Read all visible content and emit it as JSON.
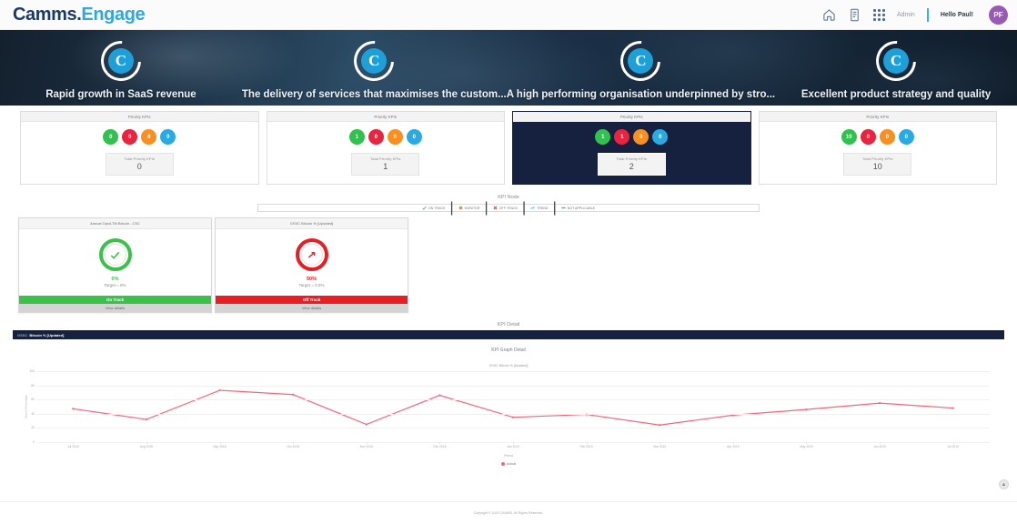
{
  "header": {
    "logo_primary": "Camms.",
    "logo_secondary": "Engage",
    "admin_label": "Admin",
    "greeting": "Hello Paul!",
    "avatar_initials": "PF",
    "icons": {
      "home": "home-icon",
      "reports": "report-icon",
      "apps": "apps-grid-icon"
    }
  },
  "banner": {
    "items": [
      {
        "logo_letter": "C",
        "text": "Rapid growth in SaaS revenue"
      },
      {
        "logo_letter": "C",
        "text": "The delivery of services that maximises the custom..."
      },
      {
        "logo_letter": "C",
        "text": "A high performing organisation underpinned by stro..."
      },
      {
        "logo_letter": "C",
        "text": "Excellent product strategy and quality"
      }
    ]
  },
  "priority_cards": {
    "head_label": "Priority KPIs",
    "total_label": "Total Priority KPIs",
    "cards": [
      {
        "selected": false,
        "badges": [
          {
            "color": "#31c14f",
            "value": "0",
            "icon": "check-icon"
          },
          {
            "color": "#e8243f",
            "value": "0",
            "icon": "cross-icon"
          },
          {
            "color": "#f79020",
            "value": "0",
            "icon": "warning-icon"
          },
          {
            "color": "#29abe2",
            "value": "0",
            "icon": "info-icon"
          }
        ],
        "total": "0"
      },
      {
        "selected": false,
        "badges": [
          {
            "color": "#31c14f",
            "value": "1",
            "icon": "check-icon"
          },
          {
            "color": "#e8243f",
            "value": "0",
            "icon": "cross-icon"
          },
          {
            "color": "#f79020",
            "value": "0",
            "icon": "warning-icon"
          },
          {
            "color": "#29abe2",
            "value": "0",
            "icon": "info-icon"
          }
        ],
        "total": "1"
      },
      {
        "selected": true,
        "badges": [
          {
            "color": "#31c14f",
            "value": "1",
            "icon": "check-icon"
          },
          {
            "color": "#e8243f",
            "value": "1",
            "icon": "cross-icon"
          },
          {
            "color": "#f79020",
            "value": "0",
            "icon": "warning-icon"
          },
          {
            "color": "#29abe2",
            "value": "0",
            "icon": "info-icon"
          }
        ],
        "total": "2"
      },
      {
        "selected": false,
        "badges": [
          {
            "color": "#31c14f",
            "value": "10",
            "icon": "check-icon"
          },
          {
            "color": "#e8243f",
            "value": "0",
            "icon": "cross-icon"
          },
          {
            "color": "#f79020",
            "value": "0",
            "icon": "warning-icon"
          },
          {
            "color": "#29abe2",
            "value": "0",
            "icon": "info-icon"
          }
        ],
        "total": "10"
      }
    ]
  },
  "kpi_node": {
    "title": "KPI Node",
    "legend": [
      {
        "label": "ON TRACK",
        "color": "#3bc14a",
        "icon": "on-track-icon"
      },
      {
        "label": "MONITOR",
        "color": "#f79020",
        "icon": "monitor-icon"
      },
      {
        "label": "OFF TRACK",
        "color": "#e61e25",
        "icon": "off-track-icon"
      },
      {
        "label": "TREND",
        "color": "#29abe2",
        "icon": "trend-icon"
      },
      {
        "label": "NOT APPLICABLE",
        "color": "#6f8ea8",
        "icon": "not-applicable-icon"
      }
    ]
  },
  "gauge_cards": [
    {
      "title": "Annual Ops/LTM Bitcoin - CSC",
      "percent": "0%",
      "target": "Target = 0%",
      "status": "On Track",
      "status_color": "#3bc14a",
      "footer": "View details",
      "icon": "check-arrow-icon"
    },
    {
      "title": "GSSC Bitcoin % [Updated]",
      "percent": "50%",
      "target": "Target = 0.0%",
      "status": "Off Track",
      "status_color": "#e61e25",
      "footer": "View details",
      "icon": "gauge-needle-icon"
    }
  ],
  "kpi_detail": {
    "title": "KPI Detail",
    "bar_prefix": "GSSC",
    "bar_label": "Bitcoin % [Updated]"
  },
  "chart_data": {
    "type": "line",
    "title": "KPI Graph Detail",
    "subtitle": "GSSC Bitcoin % [Updated]",
    "xlabel": "Period",
    "ylabel": "Bitcoin Percentage",
    "ylim": [
      0,
      100
    ],
    "yticks": [
      0,
      20,
      40,
      60,
      80,
      100
    ],
    "ytick_labels": [
      "0",
      "20",
      "40",
      "60",
      "80",
      "100"
    ],
    "grid": true,
    "legend_position": "bottom",
    "series": [
      {
        "name": "Actual",
        "color": "#f4667e",
        "values": [
          47,
          32,
          73,
          67,
          25,
          66,
          35,
          39,
          24,
          38,
          46,
          55,
          48
        ]
      }
    ],
    "categories": [
      "Jul 2018",
      "Aug 2018",
      "Sep 2018",
      "Oct 2018",
      "Nov 2018",
      "Dec 2018",
      "Jan 2019",
      "Feb 2019",
      "Mar 2019",
      "Apr 2019",
      "May 2019",
      "Jun 2019",
      "Jul 2019"
    ]
  },
  "footer": {
    "copyright": "Copyright © 2019 CAMMS. All Rights Reserved.",
    "to_top": "to-top-icon"
  }
}
